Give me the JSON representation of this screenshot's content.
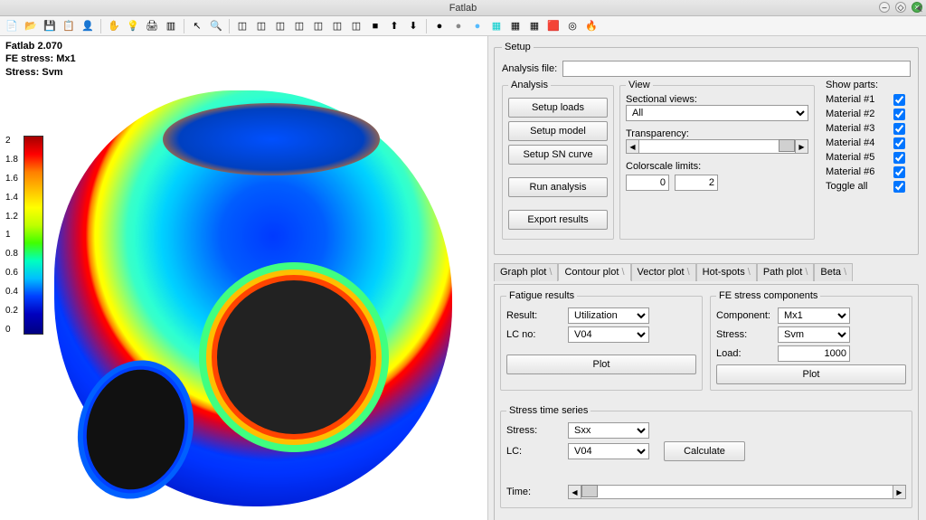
{
  "window": {
    "title": "Fatlab"
  },
  "toolbar_icons": [
    "doc-icon",
    "open-icon",
    "save-icon",
    "copy-icon",
    "person-icon",
    "hand-icon",
    "bulb-icon",
    "printer-icon",
    "layers-icon",
    "pointer-icon",
    "zoom-icon",
    "cube1-icon",
    "cube2-icon",
    "cube3-icon",
    "cube4-icon",
    "cube5-icon",
    "cube6-icon",
    "cube7-icon",
    "solid-cube-icon",
    "arrow-up-icon",
    "arrow-down-icon",
    "dot1-icon",
    "dot2-icon",
    "dot3-icon",
    "grid-cyan-icon",
    "grid4-icon",
    "grid9-icon",
    "gridcolor-icon",
    "target-icon",
    "flame-icon"
  ],
  "viewport": {
    "line1": "Fatlab 2.070",
    "line2": "FE stress: Mx1",
    "line3": "Stress: Svm",
    "colorscale": [
      "2",
      "1.8",
      "1.6",
      "1.4",
      "1.2",
      "1",
      "0.8",
      "0.6",
      "0.4",
      "0.2",
      "0"
    ]
  },
  "setup": {
    "legend": "Setup",
    "analysis_file_label": "Analysis file:",
    "analysis_file_value": "",
    "analysis": {
      "legend": "Analysis",
      "setup_loads": "Setup loads",
      "setup_model": "Setup model",
      "setup_sn": "Setup SN curve",
      "run": "Run analysis",
      "export": "Export results"
    },
    "view": {
      "legend": "View",
      "sectional_label": "Sectional views:",
      "sectional_value": "All",
      "transparency_label": "Transparency:",
      "colorscale_label": "Colorscale limits:",
      "cs_min": "0",
      "cs_max": "2"
    },
    "parts": {
      "legend": "Show parts:",
      "items": [
        "Material #1",
        "Material #2",
        "Material #3",
        "Material #4",
        "Material #5",
        "Material #6",
        "Toggle all"
      ]
    }
  },
  "tabs": {
    "items": [
      "Graph plot",
      "Contour plot",
      "Vector plot",
      "Hot-spots",
      "Path plot",
      "Beta"
    ],
    "active": 1
  },
  "fatigue": {
    "legend": "Fatigue results",
    "result_label": "Result:",
    "result_value": "Utilization",
    "lc_label": "LC no:",
    "lc_value": "V04",
    "plot": "Plot"
  },
  "festress": {
    "legend": "FE stress components",
    "component_label": "Component:",
    "component_value": "Mx1",
    "stress_label": "Stress:",
    "stress_value": "Svm",
    "load_label": "Load:",
    "load_value": "1000",
    "plot": "Plot"
  },
  "ts": {
    "legend": "Stress time series",
    "stress_label": "Stress:",
    "stress_value": "Sxx",
    "lc_label": "LC:",
    "lc_value": "V04",
    "calculate": "Calculate",
    "time_label": "Time:"
  }
}
